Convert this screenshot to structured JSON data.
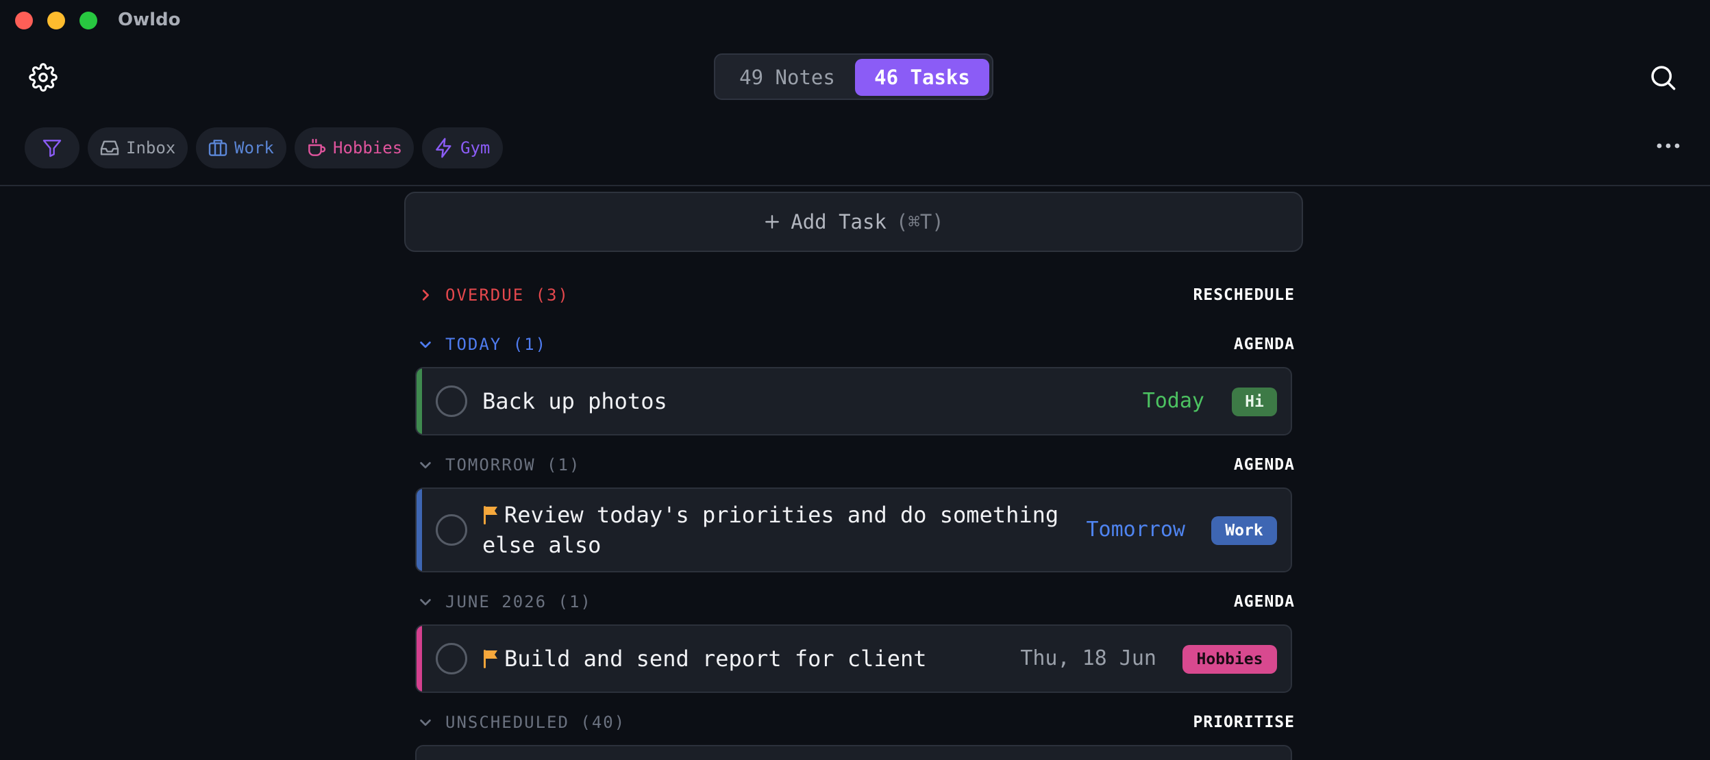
{
  "window": {
    "title": "Owldo"
  },
  "toolbar": {
    "settings_icon": "gear-icon",
    "search_icon": "search-icon",
    "more_icon": "more-horizontal-icon"
  },
  "mode_switch": {
    "notes_label": "49 Notes",
    "tasks_label": "46 Tasks",
    "active": "tasks",
    "active_color": "#8b5cf6"
  },
  "filters": {
    "filter_icon": "filter-icon",
    "items": [
      {
        "label": "Inbox",
        "icon": "inbox-icon",
        "color": "#9aa0aa"
      },
      {
        "label": "Work",
        "icon": "briefcase-icon",
        "color": "#5b86d6"
      },
      {
        "label": "Hobbies",
        "icon": "coffee-icon",
        "color": "#e0549d"
      },
      {
        "label": "Gym",
        "icon": "lightning-icon",
        "color": "#8b5cf6"
      }
    ]
  },
  "add_task": {
    "label": "Add Task",
    "shortcut": "(⌘T)"
  },
  "sections": {
    "overdue": {
      "label": "OVERDUE (3)",
      "action": "RESCHEDULE",
      "expanded": false,
      "color": "#e5484d"
    },
    "today": {
      "label": "TODAY (1)",
      "action": "AGENDA",
      "expanded": true,
      "color": "#4f7cf0"
    },
    "tomorrow": {
      "label": "TOMORROW (1)",
      "action": "AGENDA",
      "expanded": true
    },
    "june": {
      "label": "JUNE 2026 (1)",
      "action": "AGENDA",
      "expanded": true
    },
    "unscheduled": {
      "label": "UNSCHEDULED (40)",
      "action": "PRIORITISE",
      "expanded": true
    }
  },
  "tasks": [
    {
      "title": "Back up photos",
      "due": "Today",
      "tag": "Hi",
      "flagged": false,
      "color": "#3f8a4f"
    },
    {
      "title": "Review today's priorities and do something else also",
      "due": "Tomorrow",
      "tag": "Work",
      "flagged": true,
      "color": "#3e66b3"
    },
    {
      "title": "Build and send report for client",
      "due": "Thu, 18 Jun",
      "tag": "Hobbies",
      "flagged": true,
      "color": "#d4408e"
    }
  ]
}
